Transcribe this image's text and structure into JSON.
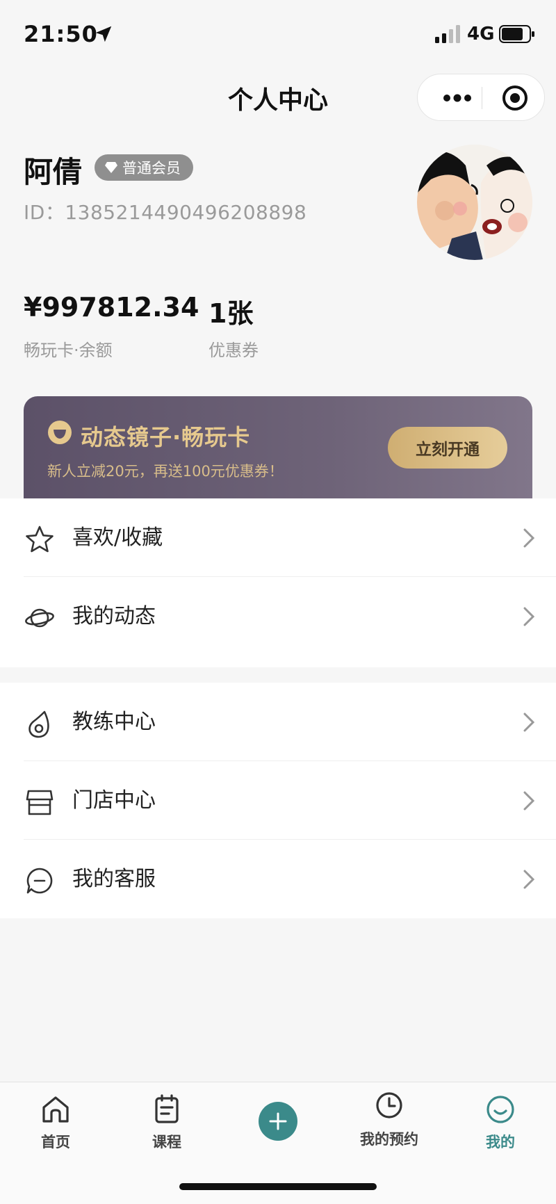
{
  "status_bar": {
    "time": "21:50",
    "network": "4G"
  },
  "header": {
    "title": "个人中心"
  },
  "profile": {
    "name": "阿倩",
    "member_level": "普通会员",
    "id_text": "ID：1385214490496208898"
  },
  "stats": [
    {
      "value": "¥997812.34",
      "label": "畅玩卡·余额"
    },
    {
      "value": "1张",
      "label": "优惠券"
    }
  ],
  "promo": {
    "title": "动态镜子·畅玩卡",
    "subtitle": "新人立减20元，再送100元优惠券！",
    "button": "立刻开通"
  },
  "menu_group_1": [
    {
      "label": "喜欢/收藏",
      "icon": "star-icon"
    },
    {
      "label": "我的动态",
      "icon": "planet-icon"
    }
  ],
  "menu_group_2": [
    {
      "label": "教练中心",
      "icon": "coach-icon"
    },
    {
      "label": "门店中心",
      "icon": "store-icon"
    },
    {
      "label": "我的客服",
      "icon": "chat-icon"
    }
  ],
  "tabs": [
    {
      "label": "首页",
      "icon": "home-icon"
    },
    {
      "label": "课程",
      "icon": "course-icon"
    },
    {
      "label": "",
      "icon": "plus-icon"
    },
    {
      "label": "我的预约",
      "icon": "clock-icon"
    },
    {
      "label": "我的",
      "icon": "smile-icon",
      "active": true
    }
  ],
  "colors": {
    "accent": "#3b8a8a",
    "promo_gold": "#e6c98e",
    "promo_bg": "#5c5168"
  }
}
